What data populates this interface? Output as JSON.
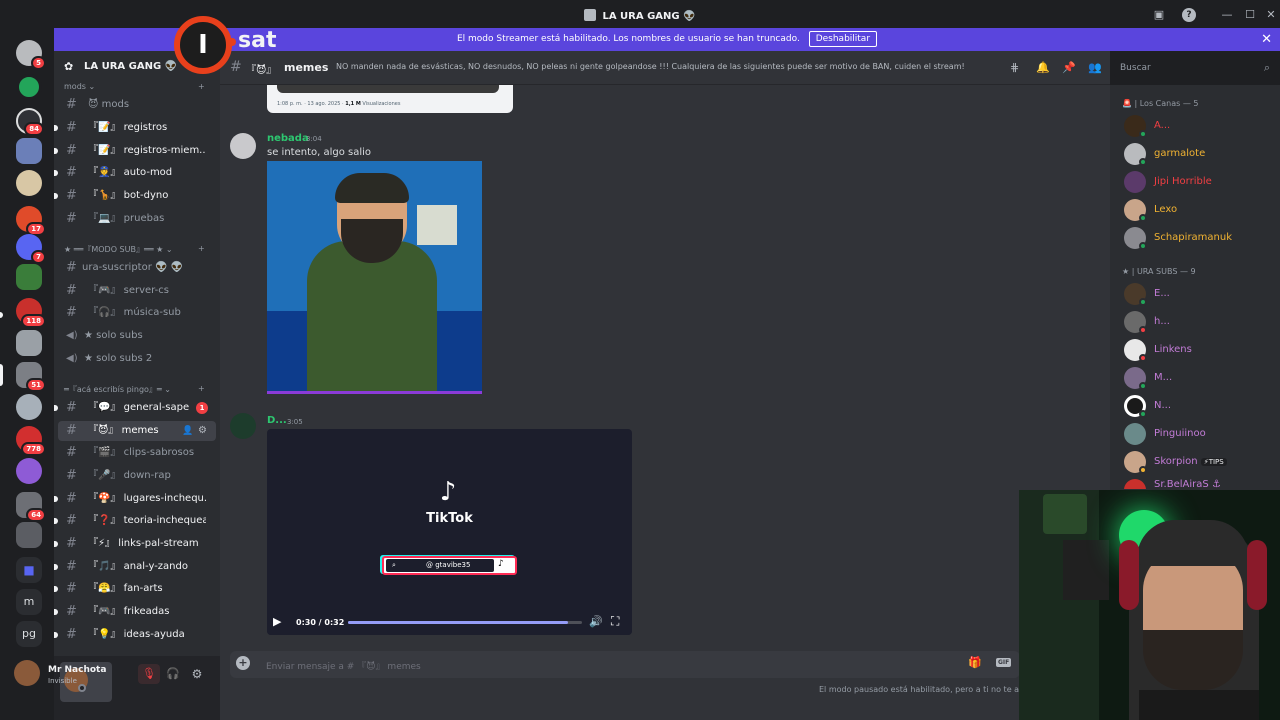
{
  "window": {
    "title": "LA URA GANG 👽"
  },
  "banner": {
    "text": "El modo Streamer está habilitado. Los nombres de usuario se han truncado.",
    "button": "Deshabilitar"
  },
  "watermark": {
    "text": "sat",
    "letter": "I"
  },
  "servers": {
    "badges": [
      "5",
      "84",
      "17",
      "7",
      "118",
      "51",
      "778",
      "64"
    ],
    "folders": [
      "m",
      "pg"
    ]
  },
  "guild": {
    "name": "LA URA GANG 👽"
  },
  "categories": {
    "mods": "mods",
    "modo_sub": "★ ══『MODO SUB』══ ★",
    "aca": "═『acá escribís pingo』═"
  },
  "channels": [
    {
      "icon": "😈",
      "name": "mods"
    },
    {
      "icon": "『📝』",
      "name": "registros"
    },
    {
      "icon": "『📝』",
      "name": "registros-miem..."
    },
    {
      "icon": "『👮』",
      "name": "auto-mod"
    },
    {
      "icon": "『🦒』",
      "name": "bot-dyno"
    },
    {
      "icon": "『💻』",
      "name": "pruebas"
    },
    {
      "name": "ura-suscriptor 👽 👽"
    },
    {
      "icon": "『🎮』",
      "name": "server-cs"
    },
    {
      "icon": "『🎧』",
      "name": "música-sub"
    },
    {
      "name": "★ solo subs"
    },
    {
      "name": "★ solo subs 2"
    },
    {
      "icon": "『💬』",
      "name": "general-sape",
      "mentions": "1"
    },
    {
      "icon": "『😈』",
      "name": "memes"
    },
    {
      "icon": "『🎬』",
      "name": "clips-sabrosos"
    },
    {
      "icon": "『🎤』",
      "name": "down-rap"
    },
    {
      "icon": "『🍄』",
      "name": "lugares-inchequ..."
    },
    {
      "icon": "『❓』",
      "name": "teoria-inchequea..."
    },
    {
      "icon": "『⚡』",
      "name": "links-pal-stream"
    },
    {
      "icon": "『🎵』",
      "name": "anal-y-zando"
    },
    {
      "icon": "『😤』",
      "name": "fan-arts"
    },
    {
      "icon": "『🎮』",
      "name": "frikeadas"
    },
    {
      "icon": "『💡』",
      "name": "ideas-ayuda"
    }
  ],
  "user": {
    "name": "Mr Nachota",
    "status": "Invisible"
  },
  "chat": {
    "channel": "memes",
    "channel_icon": "『😈』",
    "topic": "NO manden nada de esvásticas, NO desnudos, NO peleas ni gente golpeandose !!! Cualquiera de las siguientes puede ser motivo de BAN, cuiden el stream!",
    "search_placeholder": "Buscar",
    "prev_embed": {
      "time": "1:08 p. m. · 13 ago. 2025 · ",
      "views": "1,1 M",
      "views_label": "Visualizaciones"
    },
    "messages": [
      {
        "author": "nebada",
        "time": "3:04",
        "text": "se intento, algo salio",
        "color": "#2dc770"
      },
      {
        "author": "D...",
        "time": "3:05",
        "color": "#2dc770"
      }
    ],
    "video": {
      "brand": "TikTok",
      "handle": "@ gtavibe35",
      "time": "0:30 / 0:32",
      "progress": 0.94
    },
    "composer_placeholder": "Enviar mensaje a # 『😈』 memes",
    "slowmode": "El modo pausado está habilitado, pero a ti no te af"
  },
  "members": {
    "groups": [
      {
        "label": "🚨 | Los Canas — 5",
        "items": [
          {
            "name": "A...",
            "color": "#f23f43"
          },
          {
            "name": "garmalote",
            "color": "#f0b232"
          },
          {
            "name": "Jipi Horrible",
            "color": "#f23f43"
          },
          {
            "name": "Lexo",
            "color": "#f0b232"
          },
          {
            "name": "Schapiramanuk",
            "color": "#f0b232"
          }
        ]
      },
      {
        "label": "★ | URA SUBS — 9",
        "items": [
          {
            "name": "E...",
            "color": "#c27cd6"
          },
          {
            "name": "h...",
            "color": "#c27cd6"
          },
          {
            "name": "Linkens",
            "color": "#c27cd6"
          },
          {
            "name": "M...",
            "color": "#c27cd6"
          },
          {
            "name": "N...",
            "color": "#c27cd6"
          },
          {
            "name": "Pinguiinoo",
            "color": "#c27cd6"
          },
          {
            "name": "Skorpion",
            "tag": "⚡TIPS",
            "color": "#c27cd6"
          },
          {
            "name": "Sr.BelAiraS ⚓",
            "color": "#c27cd6"
          }
        ]
      }
    ]
  }
}
